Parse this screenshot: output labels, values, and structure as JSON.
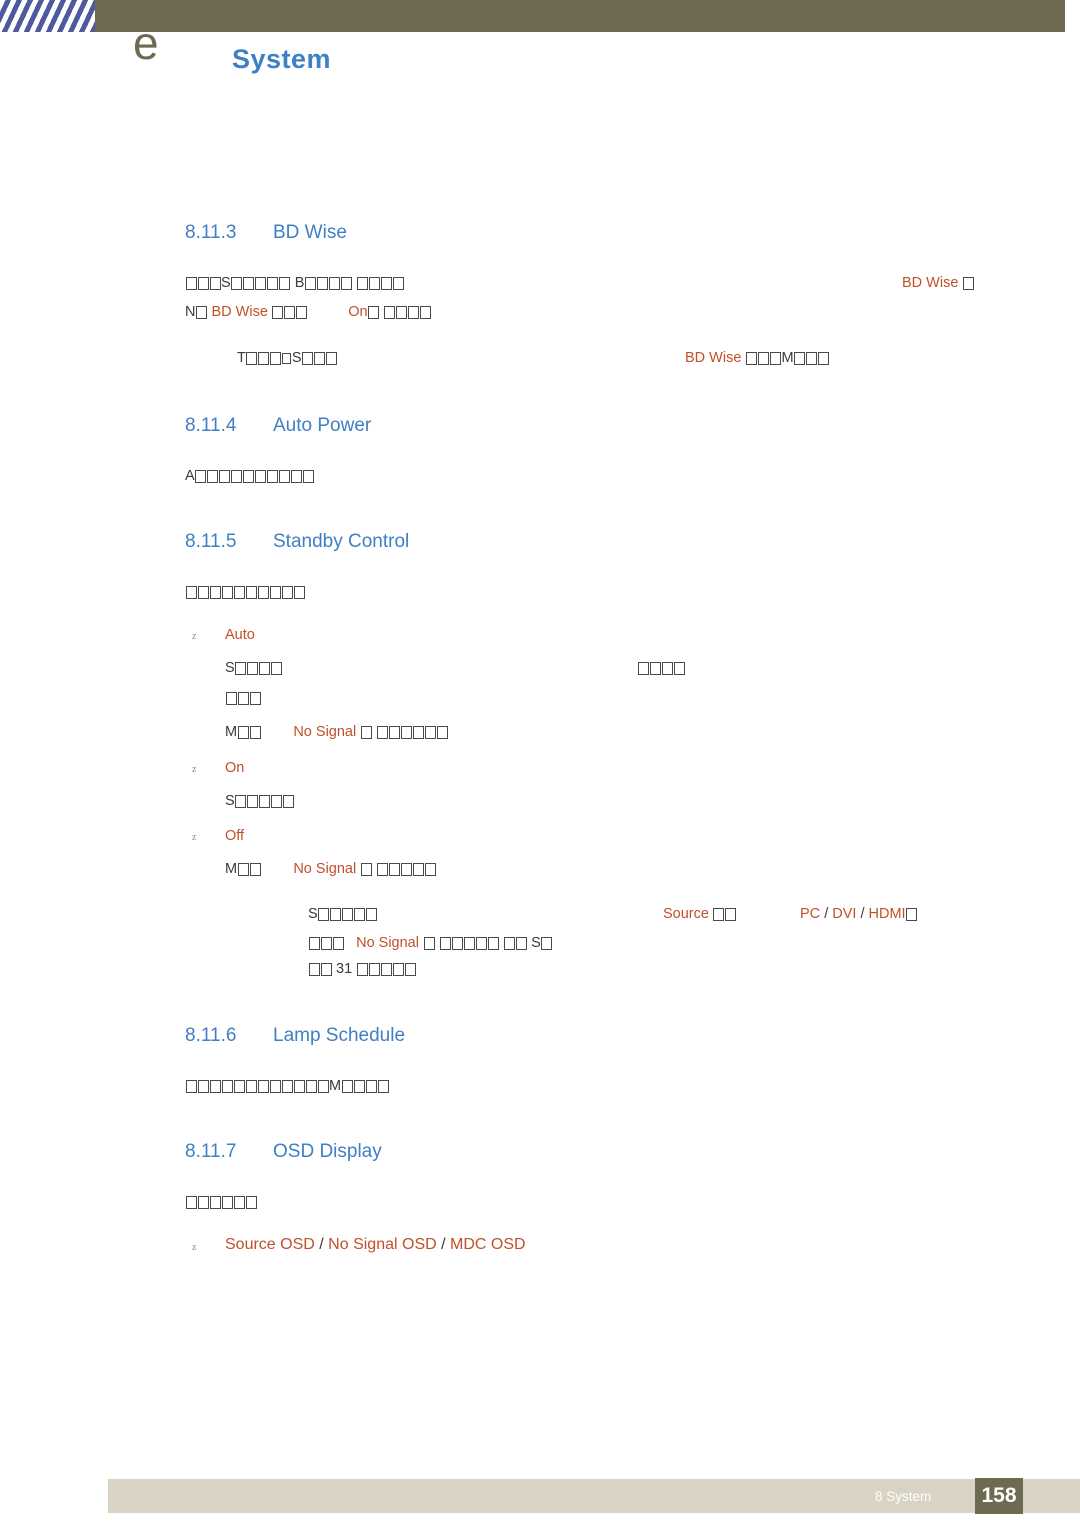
{
  "header": {
    "title": "System",
    "glyph": "e"
  },
  "sections": {
    "bd_wise": {
      "number": "8.11.3",
      "title": "BD Wise",
      "line1_a": "S",
      "line1_b": "B",
      "line1_kw": "BD Wise",
      "line2_a": "N",
      "line2_kw1": "BD Wise",
      "line2_kw2": "On",
      "note_a": "T",
      "note_kw": "BD Wise",
      "note_b": "M"
    },
    "auto_power": {
      "number": "8.11.4",
      "title": "Auto Power",
      "line1": "A"
    },
    "standby_control": {
      "number": "8.11.5",
      "title": "Standby Control",
      "intro": "",
      "opt_auto": "Auto",
      "auto_l1_a": "S",
      "auto_l1_b": "",
      "auto_l2": "",
      "auto_l3_a": "M",
      "auto_l3_kw": "No Signal",
      "opt_on": "On",
      "on_l1": "S",
      "opt_off": "Off",
      "off_l1_a": "M",
      "off_l1_kw": "No Signal",
      "note_l1_a": "S",
      "note_l1_kw1": "Source",
      "note_l1_kw2": "PC",
      "note_l1_sep1": "/",
      "note_l1_kw3": "DVI",
      "note_l1_sep2": "/",
      "note_l1_kw4": "HDMI",
      "note_l2_kw": "No Signal",
      "note_l2_tail": "S",
      "note_l3": "31"
    },
    "lamp_schedule": {
      "number": "8.11.6",
      "title": "Lamp Schedule",
      "line1": "M"
    },
    "osd_display": {
      "number": "8.11.7",
      "title": "OSD Display",
      "line1": "",
      "opt1": "Source OSD",
      "sep1": "/",
      "opt2": "No Signal OSD",
      "sep2": "/",
      "opt3": "MDC OSD"
    }
  },
  "footer": {
    "label": "8 System",
    "page": "158"
  }
}
